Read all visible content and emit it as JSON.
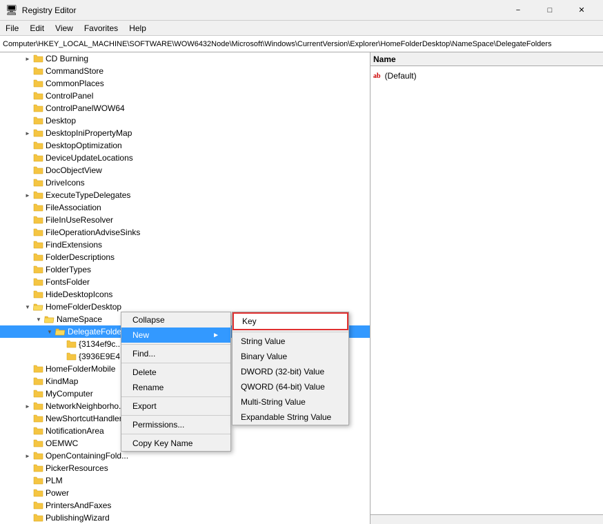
{
  "window": {
    "title": "Registry Editor",
    "icon": "🖥"
  },
  "menu": {
    "items": [
      "File",
      "Edit",
      "View",
      "Favorites",
      "Help"
    ]
  },
  "address_bar": {
    "path": "Computer\\HKEY_LOCAL_MACHINE\\SOFTWARE\\WOW6432Node\\Microsoft\\Windows\\CurrentVersion\\Explorer\\HomeFolderDesktop\\NameSpace\\DelegateFolders"
  },
  "right_pane": {
    "column_name": "Name",
    "entries": [
      {
        "icon": "ab",
        "label": "(Default)"
      }
    ]
  },
  "tree": {
    "items": [
      {
        "indent": 2,
        "expandable": true,
        "label": "CD Burning",
        "expanded": false
      },
      {
        "indent": 2,
        "expandable": false,
        "label": "CommandStore",
        "expanded": false
      },
      {
        "indent": 2,
        "expandable": false,
        "label": "CommonPlaces",
        "expanded": false
      },
      {
        "indent": 2,
        "expandable": false,
        "label": "ControlPanel",
        "expanded": false
      },
      {
        "indent": 2,
        "expandable": false,
        "label": "ControlPanelWOW64",
        "expanded": false
      },
      {
        "indent": 2,
        "expandable": false,
        "label": "Desktop",
        "expanded": false
      },
      {
        "indent": 2,
        "expandable": true,
        "label": "DesktopIniPropertyMap",
        "expanded": false
      },
      {
        "indent": 2,
        "expandable": false,
        "label": "DesktopOptimization",
        "expanded": false
      },
      {
        "indent": 2,
        "expandable": false,
        "label": "DeviceUpdateLocations",
        "expanded": false
      },
      {
        "indent": 2,
        "expandable": false,
        "label": "DocObjectView",
        "expanded": false
      },
      {
        "indent": 2,
        "expandable": false,
        "label": "DriveIcons",
        "expanded": false
      },
      {
        "indent": 2,
        "expandable": true,
        "label": "ExecuteTypeDelegates",
        "expanded": false
      },
      {
        "indent": 2,
        "expandable": false,
        "label": "FileAssociation",
        "expanded": false
      },
      {
        "indent": 2,
        "expandable": false,
        "label": "FileInUseResolver",
        "expanded": false
      },
      {
        "indent": 2,
        "expandable": false,
        "label": "FileOperationAdviseSinks",
        "expanded": false
      },
      {
        "indent": 2,
        "expandable": false,
        "label": "FindExtensions",
        "expanded": false
      },
      {
        "indent": 2,
        "expandable": false,
        "label": "FolderDescriptions",
        "expanded": false
      },
      {
        "indent": 2,
        "expandable": false,
        "label": "FolderTypes",
        "expanded": false
      },
      {
        "indent": 2,
        "expandable": false,
        "label": "FontsFolder",
        "expanded": false
      },
      {
        "indent": 2,
        "expandable": false,
        "label": "HideDesktopIcons",
        "expanded": false
      },
      {
        "indent": 2,
        "expandable": true,
        "label": "HomeFolderDesktop",
        "expanded": true
      },
      {
        "indent": 3,
        "expandable": true,
        "label": "NameSpace",
        "expanded": true
      },
      {
        "indent": 4,
        "expandable": true,
        "label": "DelegateFolders",
        "expanded": true,
        "selected": true
      },
      {
        "indent": 5,
        "expandable": false,
        "label": "{3134ef9c...",
        "expanded": false
      },
      {
        "indent": 5,
        "expandable": false,
        "label": "{3936E9E4...",
        "expanded": false
      },
      {
        "indent": 2,
        "expandable": false,
        "label": "HomeFolderMobile",
        "expanded": false
      },
      {
        "indent": 2,
        "expandable": false,
        "label": "KindMap",
        "expanded": false
      },
      {
        "indent": 2,
        "expandable": false,
        "label": "MyComputer",
        "expanded": false
      },
      {
        "indent": 2,
        "expandable": true,
        "label": "NetworkNeighborho...",
        "expanded": false
      },
      {
        "indent": 2,
        "expandable": false,
        "label": "NewShortcutHandler...",
        "expanded": false
      },
      {
        "indent": 2,
        "expandable": false,
        "label": "NotificationArea",
        "expanded": false
      },
      {
        "indent": 2,
        "expandable": false,
        "label": "OEMWC",
        "expanded": false
      },
      {
        "indent": 2,
        "expandable": true,
        "label": "OpenContainingFold...",
        "expanded": false
      },
      {
        "indent": 2,
        "expandable": false,
        "label": "PickerResources",
        "expanded": false
      },
      {
        "indent": 2,
        "expandable": false,
        "label": "PLM",
        "expanded": false
      },
      {
        "indent": 2,
        "expandable": false,
        "label": "Power",
        "expanded": false
      },
      {
        "indent": 2,
        "expandable": false,
        "label": "PrintersAndFaxes",
        "expanded": false
      },
      {
        "indent": 2,
        "expandable": false,
        "label": "PublishingWizard",
        "expanded": false
      }
    ]
  },
  "context_menu": {
    "items": [
      {
        "label": "Collapse",
        "type": "item",
        "has_submenu": false
      },
      {
        "label": "New",
        "type": "item",
        "has_submenu": true,
        "active": true
      },
      {
        "label": "",
        "type": "separator"
      },
      {
        "label": "Find...",
        "type": "item",
        "has_submenu": false
      },
      {
        "label": "",
        "type": "separator"
      },
      {
        "label": "Delete",
        "type": "item",
        "has_submenu": false
      },
      {
        "label": "Rename",
        "type": "item",
        "has_submenu": false
      },
      {
        "label": "",
        "type": "separator"
      },
      {
        "label": "Export",
        "type": "item",
        "has_submenu": false
      },
      {
        "label": "",
        "type": "separator"
      },
      {
        "label": "Permissions...",
        "type": "item",
        "has_submenu": false
      },
      {
        "label": "",
        "type": "separator"
      },
      {
        "label": "Copy Key Name",
        "type": "item",
        "has_submenu": false
      }
    ]
  },
  "submenu": {
    "items": [
      {
        "label": "Key",
        "highlighted": true
      },
      {
        "label": "",
        "type": "separator"
      },
      {
        "label": "String Value"
      },
      {
        "label": "Binary Value"
      },
      {
        "label": "DWORD (32-bit) Value"
      },
      {
        "label": "QWORD (64-bit) Value"
      },
      {
        "label": "Multi-String Value"
      },
      {
        "label": "Expandable String Value"
      }
    ]
  }
}
